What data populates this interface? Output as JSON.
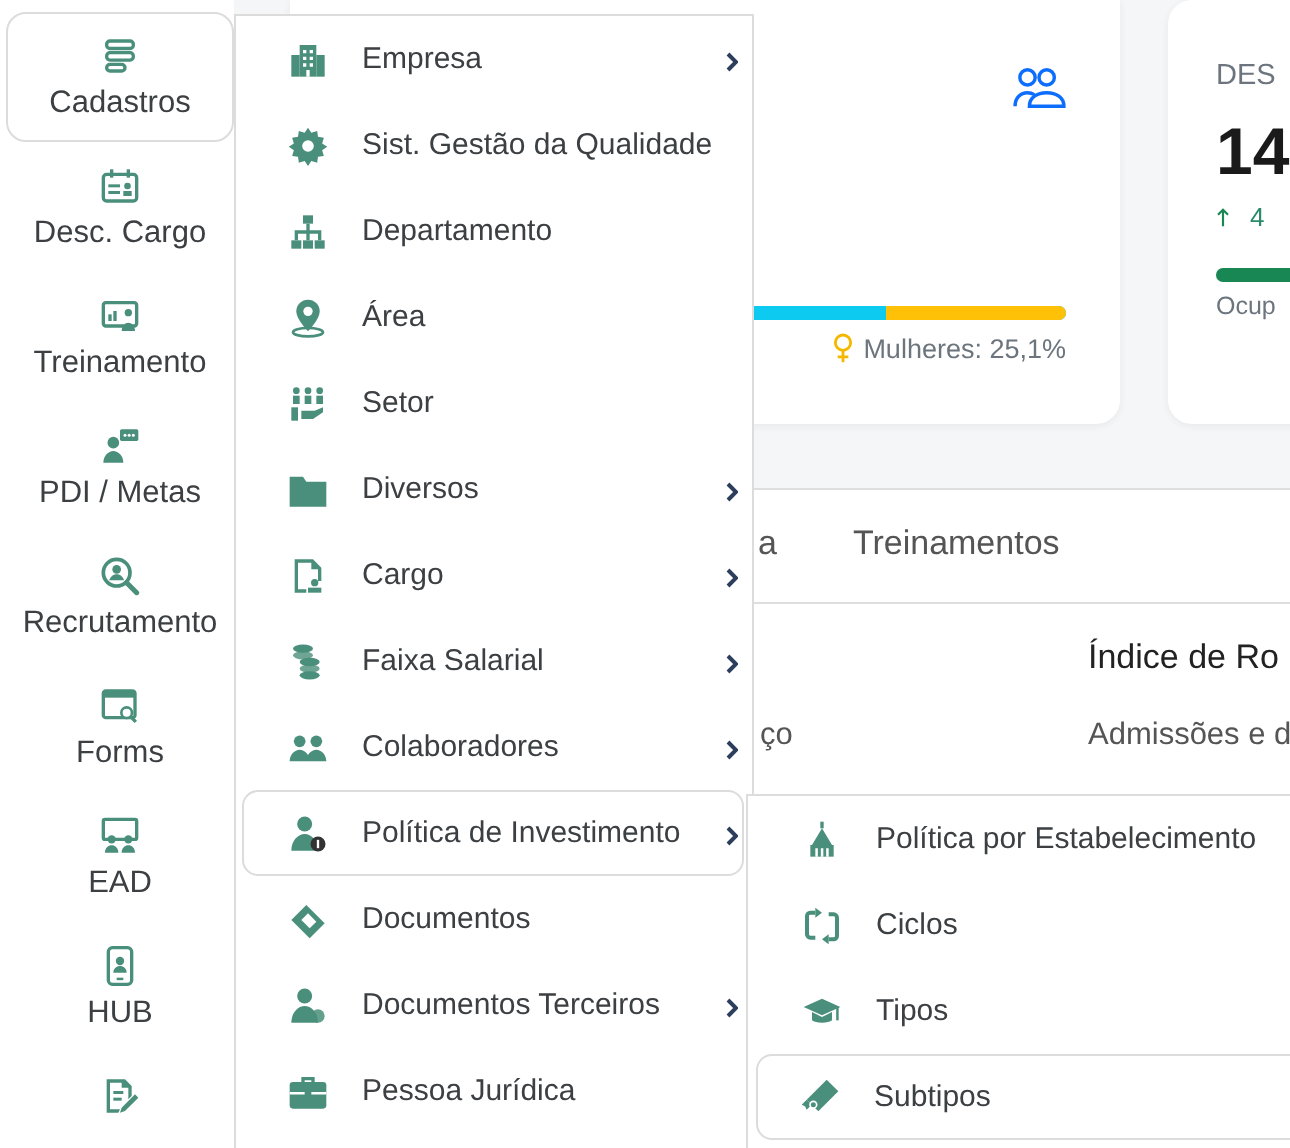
{
  "sidebar": {
    "items": [
      {
        "label": "Cadastros",
        "selected": true
      },
      {
        "label": "Desc. Cargo",
        "selected": false
      },
      {
        "label": "Treinamento",
        "selected": false
      },
      {
        "label": "PDI / Metas",
        "selected": false
      },
      {
        "label": "Recrutamento",
        "selected": false
      },
      {
        "label": "Forms",
        "selected": false
      },
      {
        "label": "EAD",
        "selected": false
      },
      {
        "label": "HUB",
        "selected": false
      }
    ]
  },
  "card_1": {
    "bar": {
      "level": 0.251
    },
    "legend": "Mulheres: 25,1%"
  },
  "card_2": {
    "title": "DES",
    "value": "14",
    "change": "4",
    "bar": {
      "level": 1
    },
    "bar_label": "Ocup"
  },
  "tabs": [
    {
      "label": "a",
      "selected": false
    },
    {
      "label": "Treinamentos",
      "selected": false
    }
  ],
  "report": {
    "heading": "Índice de Ro",
    "row": [
      "ço",
      "Admissões e d"
    ]
  },
  "menu": {
    "items": [
      {
        "label": "Empresa",
        "has_submenu": true,
        "selected": false
      },
      {
        "label": "Sist. Gestão da Qualidade",
        "has_submenu": false,
        "selected": false
      },
      {
        "label": "Departamento",
        "has_submenu": false,
        "selected": false
      },
      {
        "label": "Área",
        "has_submenu": false,
        "selected": false
      },
      {
        "label": "Setor",
        "has_submenu": false,
        "selected": false
      },
      {
        "label": "Diversos",
        "has_submenu": true,
        "selected": false
      },
      {
        "label": "Cargo",
        "has_submenu": true,
        "selected": false
      },
      {
        "label": "Faixa Salarial",
        "has_submenu": true,
        "selected": false
      },
      {
        "label": "Colaboradores",
        "has_submenu": true,
        "selected": false
      },
      {
        "label": "Política de Investimento",
        "has_submenu": true,
        "selected": true
      },
      {
        "label": "Documentos",
        "has_submenu": false,
        "selected": false
      },
      {
        "label": "Documentos Terceiros",
        "has_submenu": true,
        "selected": false
      },
      {
        "label": "Pessoa Jurídica",
        "has_submenu": false,
        "selected": false
      }
    ]
  },
  "submenu": {
    "items": [
      {
        "label": "Política por Estabelecimento",
        "selected": false
      },
      {
        "label": "Ciclos",
        "selected": false
      },
      {
        "label": "Tipos",
        "selected": false
      },
      {
        "label": "Subtipos",
        "selected": true
      }
    ]
  }
}
